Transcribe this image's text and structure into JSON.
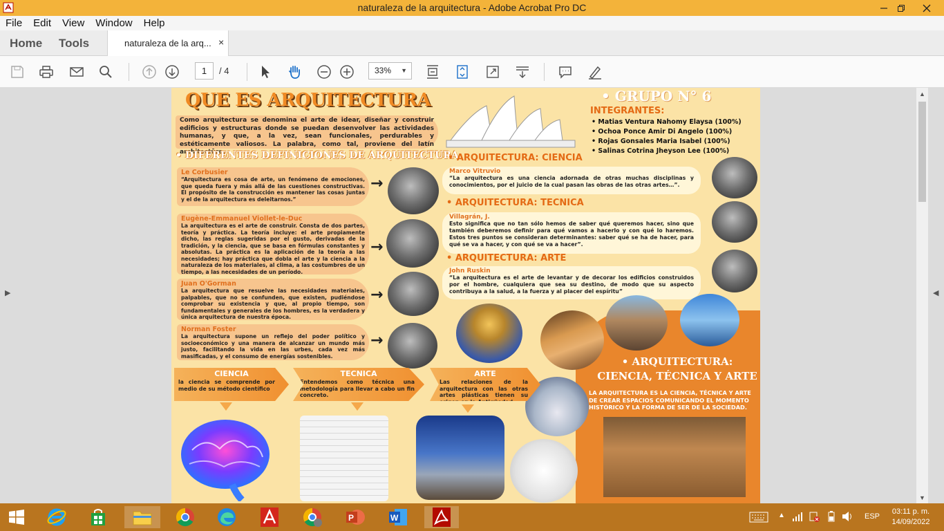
{
  "window": {
    "title": "naturaleza de la arquitectura - Adobe Acrobat Pro DC"
  },
  "menu": [
    "File",
    "Edit",
    "View",
    "Window",
    "Help"
  ],
  "tabs": {
    "home": "Home",
    "tools": "Tools",
    "document": "naturaleza de la arq...",
    "close": "×"
  },
  "toolbar": {
    "page_current": "1",
    "page_total": "/ 4",
    "zoom": "33%",
    "icons": [
      "save-icon",
      "print-icon",
      "email-icon",
      "search-icon",
      "prev-page-icon",
      "next-page-icon",
      "select-cursor-icon",
      "hand-icon",
      "zoom-out-icon",
      "zoom-in-icon",
      "scroll-mode-icon",
      "fit-page-icon",
      "fullscreen-icon",
      "read-mode-icon",
      "comment-icon",
      "sign-icon"
    ]
  },
  "poster": {
    "title": "QUE ES ARQUITECTURA",
    "intro": "Como arquitectura se denomina el arte de idear, diseñar y construir edificios y estructuras donde se puedan desenvolver las actividades humanas, y que, a la vez, sean funcionales, perdurables y estéticamente valiosos. La palabra, como tal, proviene del latín architectūra.",
    "definitions_heading": "• DIFERENTES DEFINICIONES DE ARQUITECTURA",
    "definitions": [
      {
        "author": "Le Corbusier",
        "text": "“Arquitectura es cosa de arte, un fenómeno de emociones, que queda fuera y más allá de las cuestiones constructivas. El propósito de la construcción es mantener las cosas juntas y el de la arquitectura es deleitarnos.”"
      },
      {
        "author": "Eugène-Emmanuel Viollet-le-Duc",
        "text": "La arquitectura es el arte de construir. Consta de dos partes, teoría y práctica. La teoría incluye: el arte propiamente dicho, las reglas sugeridas por el gusto, derivadas de la tradición, y la ciencia, que se basa en fórmulas constantes y absolutas. La práctica es la aplicación de la teoría a las necesidades; hay práctica que dobla el arte y la ciencia a la naturaleza de los materiales, al clima, a las costumbres de un tiempo, a las necesidades de un período."
      },
      {
        "author": "Juan O'Gorman",
        "text": "La arquitectura que resuelve las necesidades materiales, palpables, que no se confunden, que existen, pudiéndose comprobar su existencia y que, al propio tiempo, son fundamentales y generales de los hombres, es la verdadera y única arquitectura de nuestra época."
      },
      {
        "author": "Norman Foster",
        "text": "La arquitectura supone un reflejo del poder político y socioeconómico y una manera de alcanzar un mundo más justo, facilitando la vida en las urbes, cada vez más masificadas, y el consumo de energías sostenibles."
      }
    ],
    "group": {
      "title": "• GRUPO N° 6",
      "members_heading": "INTEGRANTES:",
      "members": [
        "Matias Ventura Nahomy Elaysa (100%)",
        "Ochoa Ponce Amir Di Angelo (100%)",
        "Rojas Gonsales Maria Isabel (100%)",
        "Salinas Cotrina Jheyson Lee (100%)"
      ]
    },
    "sections": [
      {
        "heading": "• ARQUITECTURA: CIENCIA",
        "author": "Marco Vitruvio",
        "text": "“La arquitectura es una ciencia adornada de otras muchas disciplinas y conocimientos, por el juicio de la cual pasan las obras de las otras artes…”."
      },
      {
        "heading": "• ARQUITECTURA: TECNICA",
        "author": "Villagrán, J.",
        "text": "Esto significa que no tan sólo hemos de saber qué queremos hacer, sino que también deberemos definir para qué vamos a hacerlo y con qué lo haremos. Estos tres puntos se consideran determinantes: saber qué se ha de hacer, para qué se va a hacer, y con qué se va a hacer”."
      },
      {
        "heading": "• ARQUITECTURA: ARTE",
        "author": "John Ruskin",
        "text": "“La arquitectura es el arte de levantar y de decorar los edificios construidos por el hombre, cualquiera que sea su destino, de modo que su aspecto contribuya a la salud, a la fuerza y al placer del espíritu”"
      }
    ],
    "pillars": [
      {
        "heading": "CIENCIA",
        "text": "la ciencia se comprende por medio de su método científico"
      },
      {
        "heading": "TECNICA",
        "text": "Entendemos como técnica una metodología para llevar a cabo un fin concreto."
      },
      {
        "heading": "ARTE",
        "text": "Las relaciones de la arquitectura con las otras artes plásticas tienen su origen en la Antigüedad."
      }
    ],
    "combined": {
      "title": "• ARQUITECTURA: CIENCIA, TÉCNICA Y ARTE",
      "text": "LA ARQUITECTURA ES LA CIENCIA, TÉCNICA Y ARTE DE CREAR ESPACIOS COMUNICANDO EL MOMENTO HISTÓRICO Y LA FORMA DE SER DE LA SOCIEDAD."
    }
  },
  "taskbar": {
    "apps": [
      "windows-start-icon",
      "internet-explorer-icon",
      "store-icon",
      "file-explorer-icon",
      "chrome-icon",
      "edge-icon",
      "acrobat-icon",
      "chrome-profile-icon",
      "powerpoint-icon",
      "word-icon",
      "acrobat-pro-icon"
    ],
    "language": "ESP",
    "time": "03:11 p. m.",
    "date": "14/09/2022"
  },
  "colors": {
    "title_bar": "#f3b33a",
    "taskbar": "#b9751f",
    "poster_bg": "#fbe3a6",
    "poster_accent": "#e46a14"
  }
}
